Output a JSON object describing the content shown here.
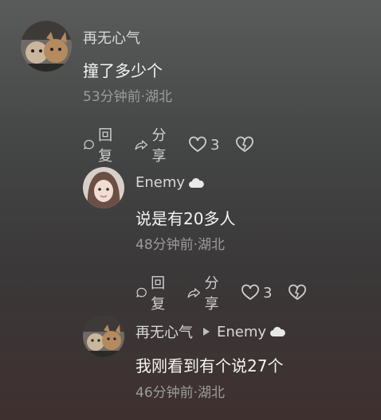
{
  "comments": [
    {
      "user": "再无心气",
      "text": "撞了多少个",
      "meta": "53分钟前·湖北",
      "reply_label": "回复",
      "share_label": "分享",
      "like_count": "3"
    },
    {
      "user": "Enemy",
      "text": "说是有20多人",
      "meta": "48分钟前·湖北",
      "reply_label": "回复",
      "share_label": "分享",
      "like_count": "3"
    },
    {
      "user": "再无心气",
      "reply_to": "Enemy",
      "text": "我刚看到有个说27个",
      "meta": "46分钟前·湖北"
    }
  ],
  "icons": {
    "reply": "speech-bubble-icon",
    "share": "share-arrow-icon",
    "like": "heart-icon",
    "dislike": "broken-heart-icon",
    "badge": "cloud-badge-icon",
    "reply_arrow": "triangle-right-icon"
  }
}
